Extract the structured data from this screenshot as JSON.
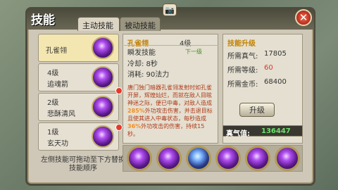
{
  "window": {
    "title": "技能",
    "tabs": [
      "主动技能",
      "被动技能"
    ],
    "close_icon": "close-icon",
    "camera_icon": "camera-icon"
  },
  "skills": [
    {
      "level": "",
      "name": "孔雀翎"
    },
    {
      "level": "4级",
      "name": "追魂箭"
    },
    {
      "level": "2级",
      "name": "悲酥清风"
    },
    {
      "level": "1级",
      "name": "玄天功"
    }
  ],
  "hint": "左侧技能可拖动至下方替换技能顺序",
  "detail": {
    "name": "孔雀翎",
    "level": "4级",
    "type": "瞬发技能",
    "next": "下一级",
    "cooldown": "冷却: 8秒",
    "mana": "消耗: 90法力",
    "desc": "唐门独门暗器孔雀翎发射时如孔雀开屏，辉煌灿烂，而就在敌人目眩神迷之际，便已中毒，对敌人造成",
    "pct1": "285%",
    "desc2": "外功攻击伤害，并击退目标且使其进入中毒状态，每秒造成",
    "pct2": "36%",
    "desc3": "外功攻击的伤害，持续15秒。"
  },
  "upgrade": {
    "title": "技能升级",
    "rows": [
      {
        "label": "所需真气:",
        "value": "17805"
      },
      {
        "label": "所需等级:",
        "value": "60"
      },
      {
        "label": "所需金币:",
        "value": "68400"
      }
    ],
    "button": "升级",
    "energy_label": "真气值:",
    "energy_value": "136447"
  }
}
